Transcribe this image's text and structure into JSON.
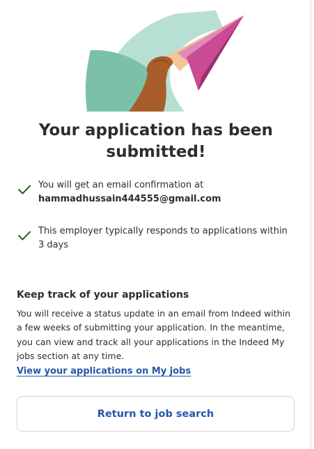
{
  "headline": "Your application has been submitted!",
  "confirmations": [
    {
      "icon": "checkmark-icon",
      "text": "You will get an email confirmation at",
      "email": "hammadhussain444555@gmail.com"
    },
    {
      "icon": "checkmark-icon",
      "text": "This employer typically responds to applications within 3 days"
    }
  ],
  "track": {
    "heading": "Keep track of your applications",
    "body": "You will receive a status update in an email from Indeed within a few weeks of submitting your application. In the meantime, you can view and track all your applications in the Indeed My jobs section at any time.",
    "link_label": "View your applications on My jobs"
  },
  "return_button_label": "Return to job search",
  "colors": {
    "accent_blue": "#2557a7",
    "check_green": "#1f662c",
    "illustration_teal": "#7cc1a7",
    "illustration_mint": "#b8dfd4",
    "plane_pink": "#c94b94",
    "plane_peach": "#f2c59a",
    "hand_brown": "#a85d2b"
  }
}
